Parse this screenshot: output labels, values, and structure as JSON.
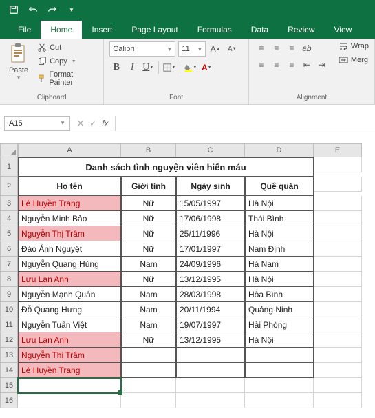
{
  "qat": {
    "save": "save",
    "undo": "undo",
    "redo": "redo"
  },
  "tabs": {
    "file": "File",
    "home": "Home",
    "insert": "Insert",
    "pageLayout": "Page Layout",
    "formulas": "Formulas",
    "data": "Data",
    "review": "Review",
    "view": "View"
  },
  "ribbon": {
    "clipboard": {
      "paste": "Paste",
      "cut": "Cut",
      "copy": "Copy",
      "formatPainter": "Format Painter",
      "label": "Clipboard"
    },
    "font": {
      "name": "Calibri",
      "size": "11",
      "label": "Font"
    },
    "alignment": {
      "wrap": "Wrap",
      "merge": "Merg",
      "label": "Alignment"
    }
  },
  "namebox": "A15",
  "columns": [
    "A",
    "B",
    "C",
    "D",
    "E"
  ],
  "sheet": {
    "title": "Danh sách tình nguyện viên hiến máu",
    "headers": {
      "name": "Họ tên",
      "gender": "Giới tính",
      "dob": "Ngày sinh",
      "home": "Quê quán"
    }
  },
  "rows": [
    {
      "n": "Lê Huyền Trang",
      "g": "Nữ",
      "d": "15/05/1997",
      "h": "Hà Nội",
      "hl": true
    },
    {
      "n": "Nguyễn Minh Bảo",
      "g": "Nữ",
      "d": "17/06/1998",
      "h": "Thái Bình",
      "hl": false
    },
    {
      "n": "Nguyễn Thị Trâm",
      "g": "Nữ",
      "d": "25/11/1996",
      "h": "Hà Nội",
      "hl": true
    },
    {
      "n": "Đào Ánh Nguyệt",
      "g": "Nữ",
      "d": "17/01/1997",
      "h": "Nam Định",
      "hl": false
    },
    {
      "n": "Nguyễn Quang Hùng",
      "g": "Nam",
      "d": "24/09/1996",
      "h": "Hà Nam",
      "hl": false
    },
    {
      "n": "Lưu Lan Anh",
      "g": "Nữ",
      "d": "13/12/1995",
      "h": "Hà Nội",
      "hl": true
    },
    {
      "n": "Nguyễn Mạnh Quân",
      "g": "Nam",
      "d": "28/03/1998",
      "h": "Hòa Bình",
      "hl": false
    },
    {
      "n": "Đỗ Quang Hưng",
      "g": "Nam",
      "d": "20/11/1994",
      "h": "Quảng Ninh",
      "hl": false
    },
    {
      "n": "Nguyễn Tuấn Việt",
      "g": "Nam",
      "d": "19/07/1997",
      "h": "Hải Phòng",
      "hl": false
    },
    {
      "n": "Lưu Lan Anh",
      "g": "Nữ",
      "d": "13/12/1995",
      "h": "Hà Nội",
      "hl": true
    },
    {
      "n": "Nguyễn Thị Trâm",
      "g": "",
      "d": "",
      "h": "",
      "hl": true
    },
    {
      "n": "Lê Huyền Trang",
      "g": "",
      "d": "",
      "h": "",
      "hl": true
    }
  ]
}
